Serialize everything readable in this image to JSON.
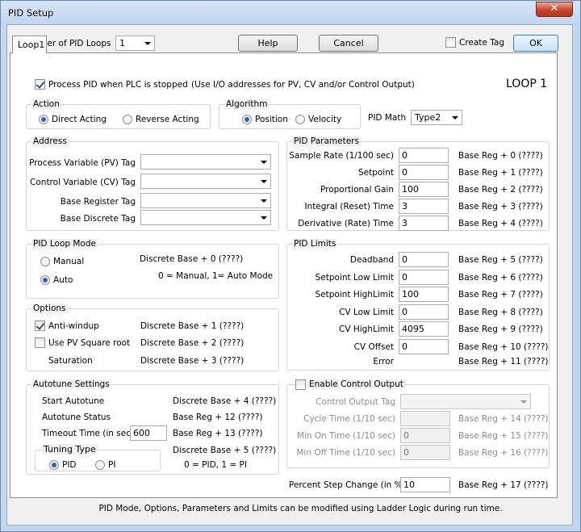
{
  "window": {
    "title": "PID Setup",
    "close_glyph": "✕"
  },
  "top": {
    "num_loops_label": "Number of PID Loops",
    "num_loops_value": "1",
    "help_label": "Help",
    "cancel_label": "Cancel",
    "create_tag_label": "Create Tag",
    "ok_label": "OK",
    "tab_label": "Loop1"
  },
  "loop": {
    "process_pid_label": "Process PID when PLC is stopped",
    "process_pid_note": "(Use I/O addresses for PV, CV and/or Control Output)",
    "heading": "LOOP 1",
    "action": {
      "title": "Action",
      "direct": "Direct Acting",
      "reverse": "Reverse Acting"
    },
    "algorithm": {
      "title": "Algorithm",
      "position": "Position",
      "velocity": "Velocity"
    },
    "pid_math_label": "PID Math",
    "pid_math_value": "Type2"
  },
  "address": {
    "title": "Address",
    "pv": "Process Variable (PV) Tag",
    "cv": "Control Variable (CV) Tag",
    "base_reg": "Base Register Tag",
    "base_disc": "Base Discrete Tag"
  },
  "params": {
    "title": "PID Parameters",
    "rows": [
      {
        "label": "Sample Rate (1/100 sec)",
        "value": "0",
        "reg": "Base Reg + 0 (????)"
      },
      {
        "label": "Setpoint",
        "value": "0",
        "reg": "Base Reg + 1 (????)"
      },
      {
        "label": "Proportional Gain",
        "value": "100",
        "reg": "Base Reg + 2 (????)"
      },
      {
        "label": "Integral (Reset) Time",
        "value": "3",
        "reg": "Base Reg + 3 (????)"
      },
      {
        "label": "Derivative (Rate) Time",
        "value": "3",
        "reg": "Base Reg + 4 (????)"
      }
    ]
  },
  "mode": {
    "title": "PID Loop Mode",
    "manual": "Manual",
    "auto": "Auto",
    "discrete": "Discrete Base + 0 (????)",
    "note": "0 = Manual,   1= Auto Mode"
  },
  "limits": {
    "title": "PID Limits",
    "rows": [
      {
        "label": "Deadband",
        "value": "0",
        "reg": "Base Reg + 5 (????)"
      },
      {
        "label": "Setpoint Low Limit",
        "value": "0",
        "reg": "Base Reg + 6 (????)"
      },
      {
        "label": "Setpoint HighLimit",
        "value": "100",
        "reg": "Base Reg + 7 (????)"
      },
      {
        "label": "CV Low Limit",
        "value": "0",
        "reg": "Base Reg + 8 (????)"
      },
      {
        "label": "CV HighLimit",
        "value": "4095",
        "reg": "Base Reg + 9 (????)"
      },
      {
        "label": "CV Offset",
        "value": "0",
        "reg": "Base Reg + 10 (????)"
      }
    ],
    "error_label": "Error",
    "error_reg": "Base Reg + 11 (????)"
  },
  "options": {
    "title": "Options",
    "antiwindup": "Anti-windup",
    "antiwindup_reg": "Discrete Base + 1 (????)",
    "sqrt": "Use PV Square root",
    "sqrt_reg": "Discrete Base + 2 (????)",
    "saturation": "Saturation",
    "saturation_reg": "Discrete Base + 3 (????)"
  },
  "autotune": {
    "title": "Autotune Settings",
    "start": "Start Autotune",
    "start_reg": "Discrete Base + 4 (????)",
    "status": "Autotune Status",
    "status_reg": "Base Reg + 12 (????)",
    "timeout": "Timeout Time (in sec)",
    "timeout_value": "600",
    "timeout_reg": "Base Reg + 13 (????)",
    "tuning_title": "Tuning Type",
    "pid": "PID",
    "pi": "PI",
    "tuning_reg": "Discrete Base + 5 (????)",
    "tuning_note": "0 = PID,  1 = PI"
  },
  "control_output": {
    "enable_label": "Enable Control Output",
    "tag_label": "Control Output Tag",
    "rows": [
      {
        "label": "Cycle Time (1/10 sec)",
        "value": "",
        "reg": "Base Reg + 14 (????)"
      },
      {
        "label": "Min On Time (1/10 sec)",
        "value": "0",
        "reg": "Base Reg + 15 (????)"
      },
      {
        "label": "Min Off Time (1/10 sec)",
        "value": "0",
        "reg": "Base Reg + 16 (????)"
      }
    ]
  },
  "step_change": {
    "label": "Percent Step Change (in %)",
    "value": "10",
    "reg": "Base Reg + 17 (????)"
  },
  "footer": "PID Mode, Options, Parameters and Limits can be modified using Ladder Logic during run time."
}
